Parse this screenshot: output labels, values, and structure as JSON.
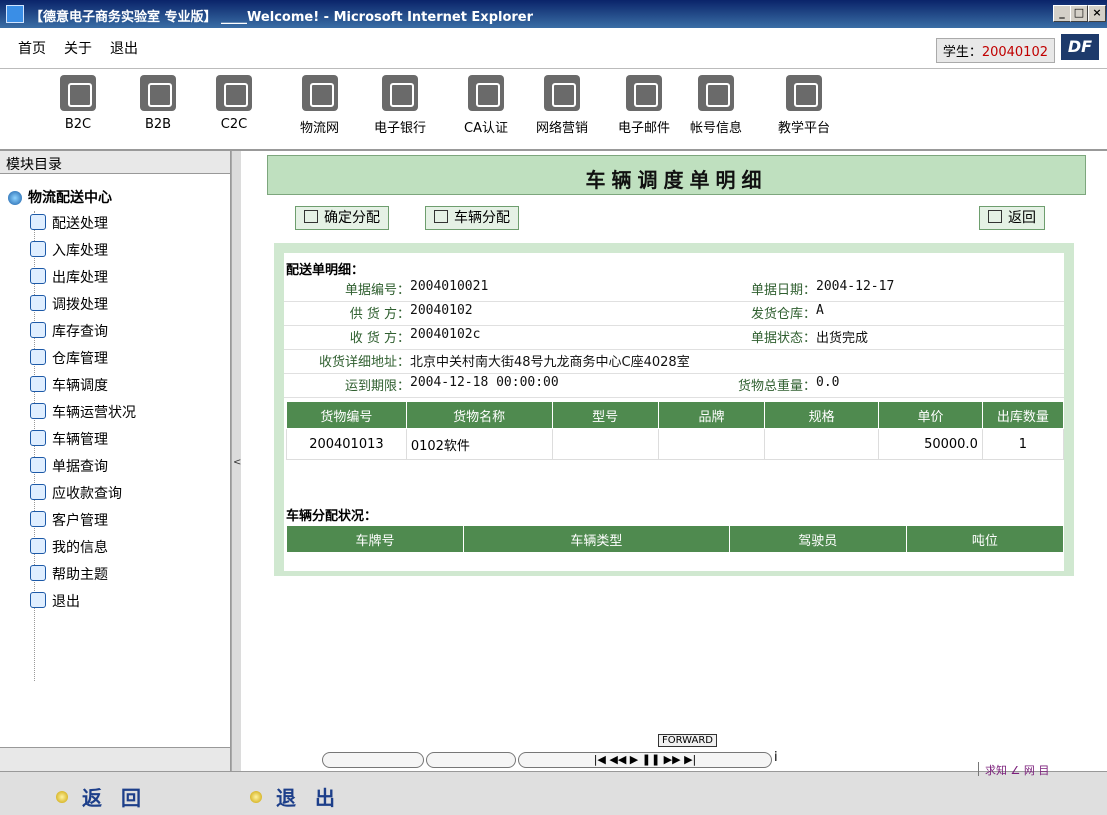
{
  "window": {
    "title": "【德意电子商务实验室 专业版】 ____Welcome! - Microsoft Internet Explorer",
    "min": "_",
    "max": "□",
    "close": "×"
  },
  "menu": {
    "home": "首页",
    "about": "关于",
    "exit": "退出"
  },
  "student": {
    "label": "学生：",
    "id": "20040102"
  },
  "logo": "DF",
  "toolbar": [
    {
      "label": "B2C",
      "icon": "cart-icon"
    },
    {
      "label": "B2B",
      "icon": "network-icon"
    },
    {
      "label": "C2C",
      "icon": "c2c-icon"
    },
    {
      "label": "物流网",
      "icon": "truck-icon"
    },
    {
      "label": "电子银行",
      "icon": "bank-icon"
    },
    {
      "label": "CA认证",
      "icon": "certificate-icon"
    },
    {
      "label": "网络营销",
      "icon": "marketing-icon"
    },
    {
      "label": "电子邮件",
      "icon": "email-icon"
    },
    {
      "label": "帐号信息",
      "icon": "help-icon"
    },
    {
      "label": "教学平台",
      "icon": "teaching-icon"
    }
  ],
  "sidebar": {
    "heading": "模块目录",
    "root": "物流配送中心",
    "items": [
      "配送处理",
      "入库处理",
      "出库处理",
      "调拨处理",
      "库存查询",
      "仓库管理",
      "车辆调度",
      "车辆运营状况",
      "车辆管理",
      "单据查询",
      "应收款查询",
      "客户管理",
      "我的信息",
      "帮助主题",
      "退出"
    ]
  },
  "main": {
    "header": "车辆调度单明细",
    "buttons": {
      "confirm": "确定分配",
      "vehicle": "车辆分配",
      "back": "返回"
    },
    "detail_title": "配送单明细：",
    "fields": {
      "doc_no_label": "单据编号：",
      "doc_no": "2004010021",
      "doc_date_label": "单据日期：",
      "doc_date": "2004-12-17",
      "supplier_label": "供 货 方：",
      "supplier": "20040102",
      "warehouse_label": "发货仓库：",
      "warehouse": "A",
      "receiver_label": "收 货 方：",
      "receiver": "20040102c",
      "status_label": "单据状态：",
      "status": "出货完成",
      "address_label": "收货详细地址：",
      "address": "北京中关村南大街48号九龙商务中心C座4028室",
      "deadline_label": "运到期限：",
      "deadline": "2004-12-18 00:00:00",
      "weight_label": "货物总重量：",
      "weight": "0.0"
    },
    "goods_columns": [
      "货物编号",
      "货物名称",
      "型号",
      "品牌",
      "规格",
      "单价",
      "出库数量"
    ],
    "goods_rows": [
      [
        "200401013",
        "0102软件",
        "",
        "",
        "",
        "50000.0",
        "1"
      ]
    ],
    "vehicle_title": "车辆分配状况：",
    "vehicle_columns": [
      "车牌号",
      "车辆类型",
      "驾驶员",
      "吨位"
    ]
  },
  "media": {
    "forward": "FORWARD",
    "info": "i"
  },
  "bottom": {
    "back": "返 回",
    "exit": "退 出"
  },
  "corner_logo": "求知 ∠ 网 目"
}
